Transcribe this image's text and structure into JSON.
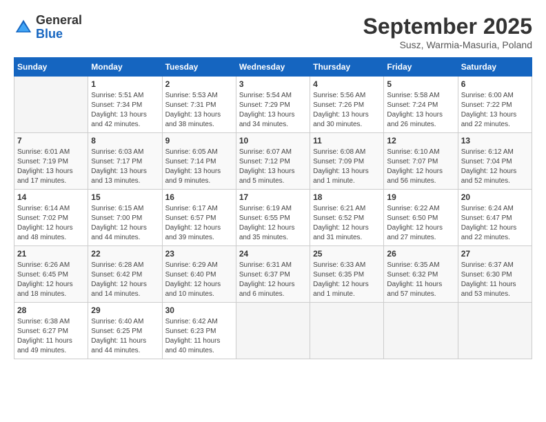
{
  "logo": {
    "general": "General",
    "blue": "Blue"
  },
  "title": "September 2025",
  "subtitle": "Susz, Warmia-Masuria, Poland",
  "days_of_week": [
    "Sunday",
    "Monday",
    "Tuesday",
    "Wednesday",
    "Thursday",
    "Friday",
    "Saturday"
  ],
  "weeks": [
    [
      {
        "day": "",
        "info": ""
      },
      {
        "day": "1",
        "info": "Sunrise: 5:51 AM\nSunset: 7:34 PM\nDaylight: 13 hours\nand 42 minutes."
      },
      {
        "day": "2",
        "info": "Sunrise: 5:53 AM\nSunset: 7:31 PM\nDaylight: 13 hours\nand 38 minutes."
      },
      {
        "day": "3",
        "info": "Sunrise: 5:54 AM\nSunset: 7:29 PM\nDaylight: 13 hours\nand 34 minutes."
      },
      {
        "day": "4",
        "info": "Sunrise: 5:56 AM\nSunset: 7:26 PM\nDaylight: 13 hours\nand 30 minutes."
      },
      {
        "day": "5",
        "info": "Sunrise: 5:58 AM\nSunset: 7:24 PM\nDaylight: 13 hours\nand 26 minutes."
      },
      {
        "day": "6",
        "info": "Sunrise: 6:00 AM\nSunset: 7:22 PM\nDaylight: 13 hours\nand 22 minutes."
      }
    ],
    [
      {
        "day": "7",
        "info": "Sunrise: 6:01 AM\nSunset: 7:19 PM\nDaylight: 13 hours\nand 17 minutes."
      },
      {
        "day": "8",
        "info": "Sunrise: 6:03 AM\nSunset: 7:17 PM\nDaylight: 13 hours\nand 13 minutes."
      },
      {
        "day": "9",
        "info": "Sunrise: 6:05 AM\nSunset: 7:14 PM\nDaylight: 13 hours\nand 9 minutes."
      },
      {
        "day": "10",
        "info": "Sunrise: 6:07 AM\nSunset: 7:12 PM\nDaylight: 13 hours\nand 5 minutes."
      },
      {
        "day": "11",
        "info": "Sunrise: 6:08 AM\nSunset: 7:09 PM\nDaylight: 13 hours\nand 1 minute."
      },
      {
        "day": "12",
        "info": "Sunrise: 6:10 AM\nSunset: 7:07 PM\nDaylight: 12 hours\nand 56 minutes."
      },
      {
        "day": "13",
        "info": "Sunrise: 6:12 AM\nSunset: 7:04 PM\nDaylight: 12 hours\nand 52 minutes."
      }
    ],
    [
      {
        "day": "14",
        "info": "Sunrise: 6:14 AM\nSunset: 7:02 PM\nDaylight: 12 hours\nand 48 minutes."
      },
      {
        "day": "15",
        "info": "Sunrise: 6:15 AM\nSunset: 7:00 PM\nDaylight: 12 hours\nand 44 minutes."
      },
      {
        "day": "16",
        "info": "Sunrise: 6:17 AM\nSunset: 6:57 PM\nDaylight: 12 hours\nand 39 minutes."
      },
      {
        "day": "17",
        "info": "Sunrise: 6:19 AM\nSunset: 6:55 PM\nDaylight: 12 hours\nand 35 minutes."
      },
      {
        "day": "18",
        "info": "Sunrise: 6:21 AM\nSunset: 6:52 PM\nDaylight: 12 hours\nand 31 minutes."
      },
      {
        "day": "19",
        "info": "Sunrise: 6:22 AM\nSunset: 6:50 PM\nDaylight: 12 hours\nand 27 minutes."
      },
      {
        "day": "20",
        "info": "Sunrise: 6:24 AM\nSunset: 6:47 PM\nDaylight: 12 hours\nand 22 minutes."
      }
    ],
    [
      {
        "day": "21",
        "info": "Sunrise: 6:26 AM\nSunset: 6:45 PM\nDaylight: 12 hours\nand 18 minutes."
      },
      {
        "day": "22",
        "info": "Sunrise: 6:28 AM\nSunset: 6:42 PM\nDaylight: 12 hours\nand 14 minutes."
      },
      {
        "day": "23",
        "info": "Sunrise: 6:29 AM\nSunset: 6:40 PM\nDaylight: 12 hours\nand 10 minutes."
      },
      {
        "day": "24",
        "info": "Sunrise: 6:31 AM\nSunset: 6:37 PM\nDaylight: 12 hours\nand 6 minutes."
      },
      {
        "day": "25",
        "info": "Sunrise: 6:33 AM\nSunset: 6:35 PM\nDaylight: 12 hours\nand 1 minute."
      },
      {
        "day": "26",
        "info": "Sunrise: 6:35 AM\nSunset: 6:32 PM\nDaylight: 11 hours\nand 57 minutes."
      },
      {
        "day": "27",
        "info": "Sunrise: 6:37 AM\nSunset: 6:30 PM\nDaylight: 11 hours\nand 53 minutes."
      }
    ],
    [
      {
        "day": "28",
        "info": "Sunrise: 6:38 AM\nSunset: 6:27 PM\nDaylight: 11 hours\nand 49 minutes."
      },
      {
        "day": "29",
        "info": "Sunrise: 6:40 AM\nSunset: 6:25 PM\nDaylight: 11 hours\nand 44 minutes."
      },
      {
        "day": "30",
        "info": "Sunrise: 6:42 AM\nSunset: 6:23 PM\nDaylight: 11 hours\nand 40 minutes."
      },
      {
        "day": "",
        "info": ""
      },
      {
        "day": "",
        "info": ""
      },
      {
        "day": "",
        "info": ""
      },
      {
        "day": "",
        "info": ""
      }
    ]
  ]
}
